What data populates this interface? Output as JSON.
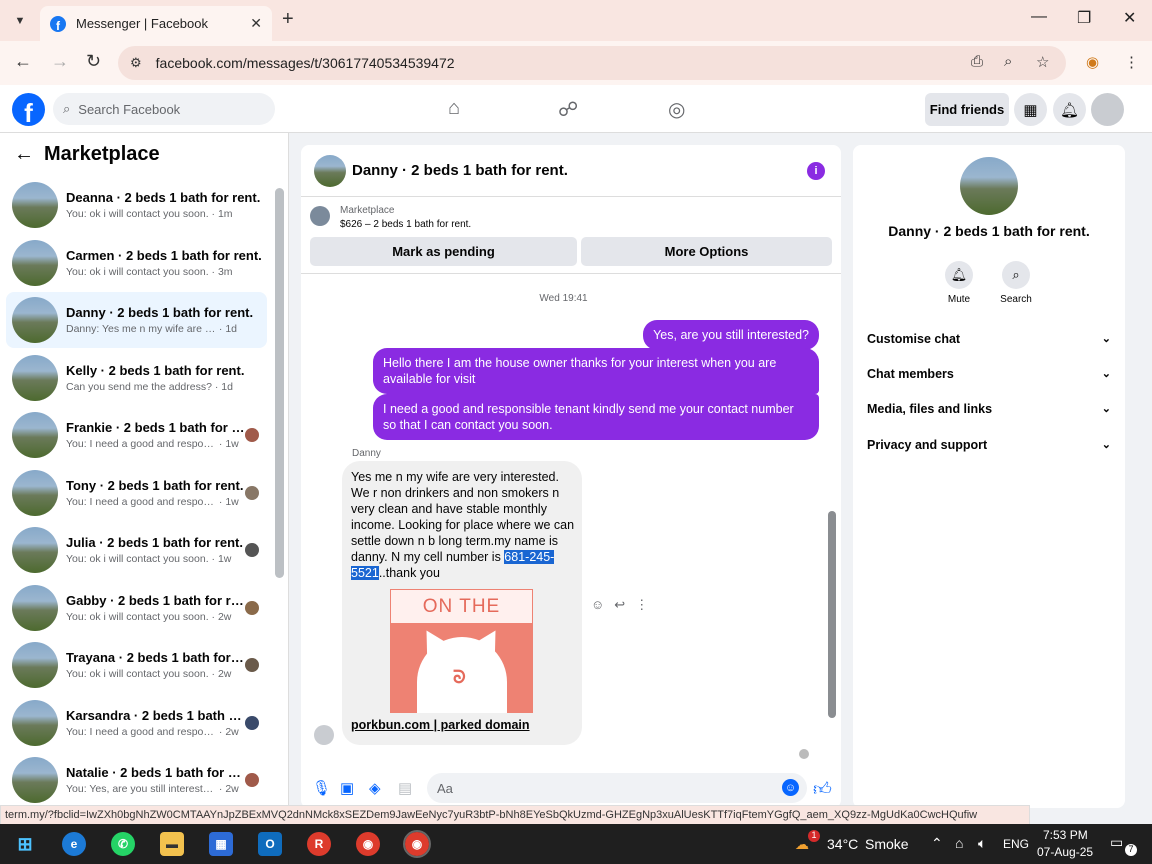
{
  "browser": {
    "tab_title": "Messenger | Facebook",
    "url": "facebook.com/messages/t/30617740534539472",
    "status_link": "term.my/?fbclid=IwZXh0bgNhZW0CMTAAYnJpZBExMVQ2dnNMck8xSEZDem9JawEeNyc7yuR3btP-bNh8EYeSbQkUzmd-GHZEgNp3xuAlUesKTTf7iqFtemYGgfQ_aem_XQ9zz-MgUdKa0CwcHQufiw"
  },
  "fb": {
    "search_placeholder": "Search Facebook",
    "find_friends": "Find friends"
  },
  "sidebar": {
    "title": "Marketplace",
    "conversations": [
      {
        "name": "Deanna · 2 beds 1 bath for rent.",
        "preview": "You: ok i will contact you soon.",
        "time": "1m"
      },
      {
        "name": "Carmen · 2 beds 1 bath for rent.",
        "preview": "You: ok i will contact you soon.",
        "time": "3m"
      },
      {
        "name": "Danny · 2 beds 1 bath for rent.",
        "preview": "Danny: Yes me n my wife are very i...",
        "time": "1d"
      },
      {
        "name": "Kelly · 2 beds 1 bath for rent.",
        "preview": "Can you send me the address?",
        "time": "1d"
      },
      {
        "name": "Frankie · 2 beds 1 bath for rent.",
        "preview": "You: I need a good and respons...",
        "time": "1w"
      },
      {
        "name": "Tony · 2 beds 1 bath for rent.",
        "preview": "You: I need a good and respons...",
        "time": "1w"
      },
      {
        "name": "Julia · 2 beds 1 bath for rent.",
        "preview": "You: ok i will contact you soon.",
        "time": "1w"
      },
      {
        "name": "Gabby · 2 beds 1 bath for rent.",
        "preview": "You: ok i will contact you soon.",
        "time": "2w"
      },
      {
        "name": "Trayana · 2 beds 1 bath for re...",
        "preview": "You: ok i will contact you soon.",
        "time": "2w"
      },
      {
        "name": "Karsandra · 2 beds 1 bath for ...",
        "preview": "You: I need a good and respons...",
        "time": "2w"
      },
      {
        "name": "Natalie · 2 beds 1 bath for rent.",
        "preview": "You: Yes, are you still interested?",
        "time": "2w"
      }
    ]
  },
  "chat": {
    "title": "Danny · 2 beds 1 bath for rent.",
    "marketplace_label": "Marketplace",
    "listing": "$626 – 2 beds 1 bath for rent.",
    "mark_pending": "Mark as pending",
    "more_options": "More Options",
    "timestamp": "Wed 19:41",
    "out_messages": [
      "Yes, are you still interested?",
      "Hello there I am the house owner thanks for your interest when you are available for visit",
      "I need a good and responsible tenant kindly send me your contact number so that I can contact you soon."
    ],
    "sender": "Danny",
    "in_message_before": "Yes me n my wife are very interested. We r non drinkers and non smokers n very clean and have stable monthly income. Looking for place where we can settle down n b long term.my name is danny. N my cell number is ",
    "in_message_phone": "681-245-5521",
    "in_message_after": "..thank you",
    "link_image_text": "ON THE",
    "link_title": "porkbun.com | parked domain",
    "composer_placeholder": "Aa"
  },
  "details": {
    "name": "Danny · 2 beds 1 bath for rent.",
    "mute": "Mute",
    "search": "Search",
    "sections": [
      "Customise chat",
      "Chat members",
      "Media, files and links",
      "Privacy and support"
    ]
  },
  "taskbar": {
    "weather": "34°C",
    "weather_desc": "Smoke",
    "lang": "ENG",
    "time": "7:53 PM",
    "date": "07-Aug-25",
    "notif_count": "7",
    "chrome_badge": "1"
  },
  "colors": {
    "accent": "#8a2be2",
    "fb_blue": "#0866ff"
  }
}
